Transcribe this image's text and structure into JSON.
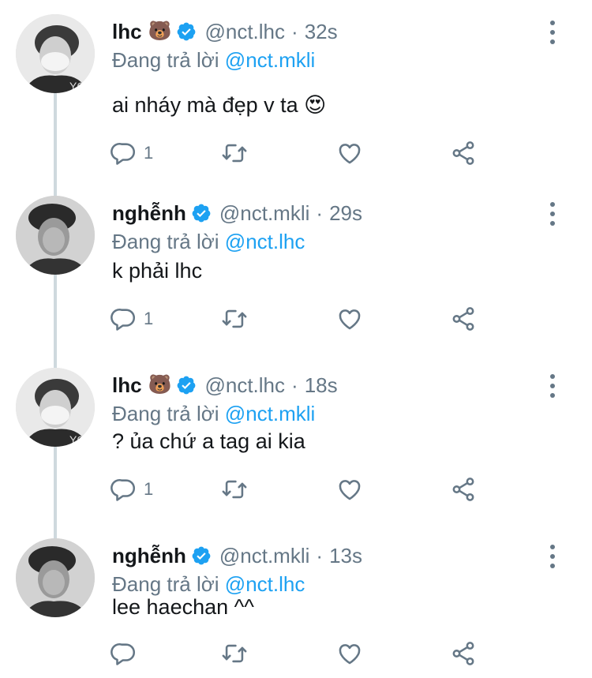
{
  "tweets": [
    {
      "name": "lhc",
      "emoji": "🐻",
      "handle": "@nct.lhc",
      "time": "32s",
      "reply_prefix": "Đang trả lời",
      "reply_to": "@nct.mkli",
      "text": "ai nháy mà đẹp v ta 😍",
      "reply_count": "1"
    },
    {
      "name": "nghễnh",
      "emoji": "",
      "handle": "@nct.mkli",
      "time": "29s",
      "reply_prefix": "Đang trả lời",
      "reply_to": "@nct.lhc",
      "text": "k phải lhc",
      "reply_count": "1"
    },
    {
      "name": "lhc",
      "emoji": "🐻",
      "handle": "@nct.lhc",
      "time": "18s",
      "reply_prefix": "Đang trả lời",
      "reply_to": "@nct.mkli",
      "text": "? ủa chứ a tag ai kia",
      "reply_count": "1"
    },
    {
      "name": "nghễnh",
      "emoji": "",
      "handle": "@nct.mkli",
      "time": "13s",
      "reply_prefix": "Đang trả lời",
      "reply_to": "@nct.lhc",
      "text": "lee haechan ^^",
      "reply_count": ""
    }
  ],
  "separator": "·",
  "colors": {
    "link": "#1da1f2",
    "secondary_text": "#657786",
    "primary_text": "#14171a",
    "thread_line": "#cfd9de",
    "verified_badge": "#1da1f2"
  },
  "icons": [
    "verified-badge-icon",
    "more-vertical-icon",
    "reply-icon",
    "retweet-icon",
    "like-icon",
    "share-icon"
  ]
}
